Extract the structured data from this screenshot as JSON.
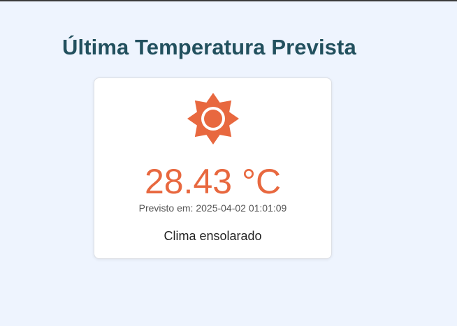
{
  "page": {
    "title": "Última Temperatura Prevista"
  },
  "weather": {
    "icon": "sun-icon",
    "accent_color": "#e8683f",
    "temperature": "28.43 °C",
    "forecast_label": "Previsto em:",
    "forecast_time": "2025-04-02 01:01:09",
    "condition": "Clima ensolarado"
  },
  "colors": {
    "background": "#eef4fe",
    "title": "#22505e",
    "card": "#ffffff"
  }
}
